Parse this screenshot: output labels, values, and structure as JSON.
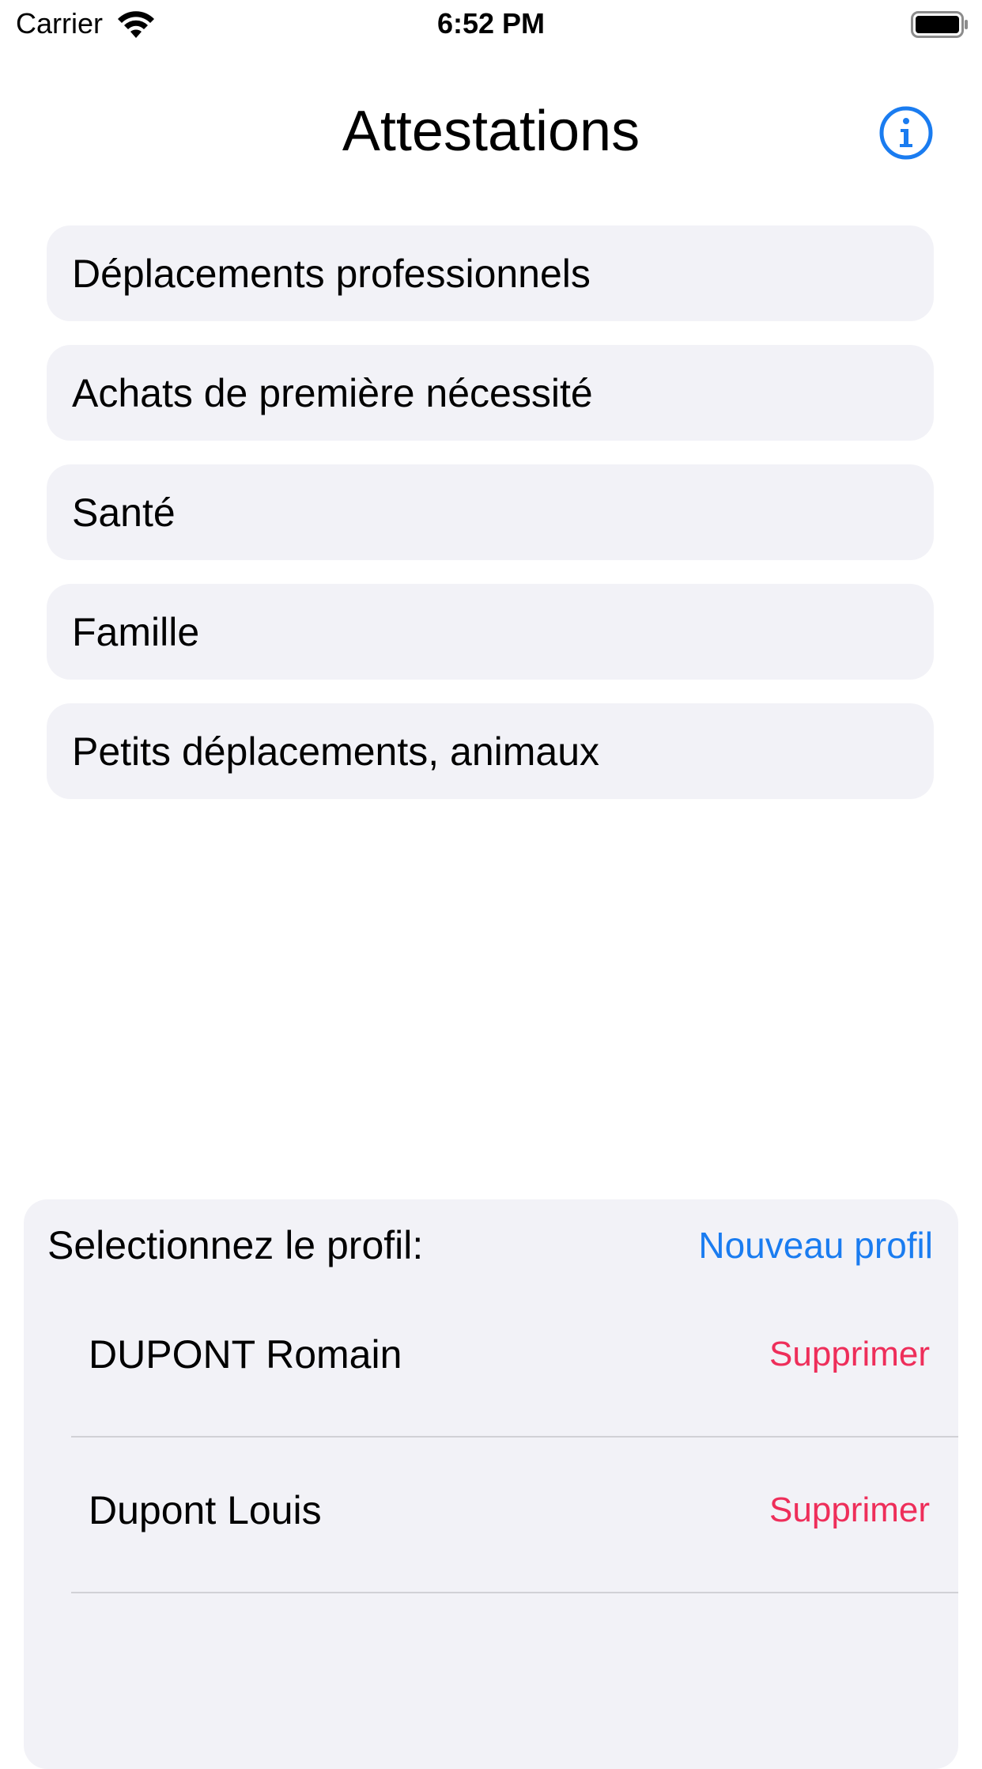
{
  "status_bar": {
    "carrier": "Carrier",
    "time": "6:52 PM"
  },
  "header": {
    "title": "Attestations",
    "info_icon": "info-circle-icon"
  },
  "categories": [
    {
      "label": "Déplacements professionnels"
    },
    {
      "label": "Achats de première nécessité"
    },
    {
      "label": "Santé"
    },
    {
      "label": "Famille"
    },
    {
      "label": "Petits déplacements, animaux"
    }
  ],
  "profiles_panel": {
    "title": "Selectionnez le profil:",
    "new_profile_label": "Nouveau profil",
    "profiles": [
      {
        "name": "DUPONT Romain",
        "delete_label": "Supprimer"
      },
      {
        "name": "Dupont Louis",
        "delete_label": "Supprimer"
      }
    ]
  },
  "colors": {
    "accent": "#1a7cf0",
    "destructive": "#ee2e5a",
    "cell_background": "#f2f2f7",
    "separator": "#d1d1d6"
  }
}
